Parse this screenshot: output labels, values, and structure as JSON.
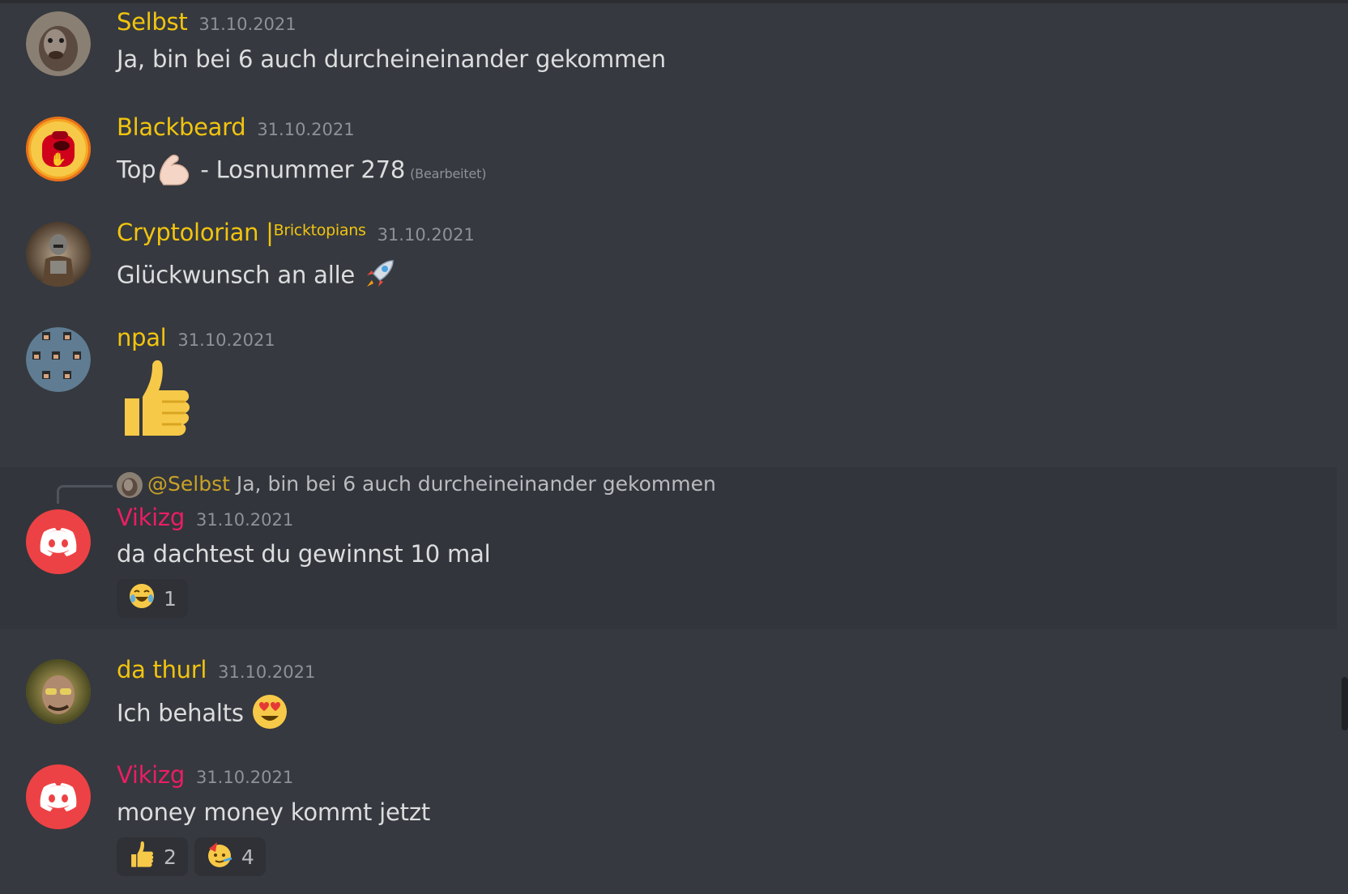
{
  "messages": [
    {
      "author": "Selbst",
      "timestamp": "31.10.2021",
      "text": "Ja, bin bei 6 auch durcheineinander gekommen"
    },
    {
      "author": "Blackbeard",
      "timestamp": "31.10.2021",
      "text_before": "Top",
      "text_after": " - Losnummer 278",
      "edited": "(Bearbeitet)"
    },
    {
      "author": "Cryptolorian |",
      "author_tag": "Bricktopians",
      "timestamp": "31.10.2021",
      "text": "Glückwunsch an alle"
    },
    {
      "author": "npal",
      "timestamp": "31.10.2021"
    },
    {
      "author": "Vikizg",
      "timestamp": "31.10.2021",
      "text": "da dachtest du gewinnst 10 mal",
      "reply": {
        "mention": "@Selbst",
        "text": "Ja, bin bei 6 auch durcheineinander gekommen"
      },
      "reactions": [
        {
          "emoji": "laughing-crying",
          "count": "1"
        }
      ]
    },
    {
      "author": "da thurl",
      "timestamp": "31.10.2021",
      "text": "Ich behalts"
    },
    {
      "author": "Vikizg",
      "timestamp": "31.10.2021",
      "text": "money money kommt jetzt",
      "reactions": [
        {
          "emoji": "thumbs-up",
          "count": "2"
        },
        {
          "emoji": "partying-face",
          "count": "4"
        }
      ]
    }
  ],
  "colors": {
    "background": "#36393f",
    "username_yellow": "#f1c40f",
    "username_red": "#e91e63",
    "discord_red": "#ed4245"
  }
}
